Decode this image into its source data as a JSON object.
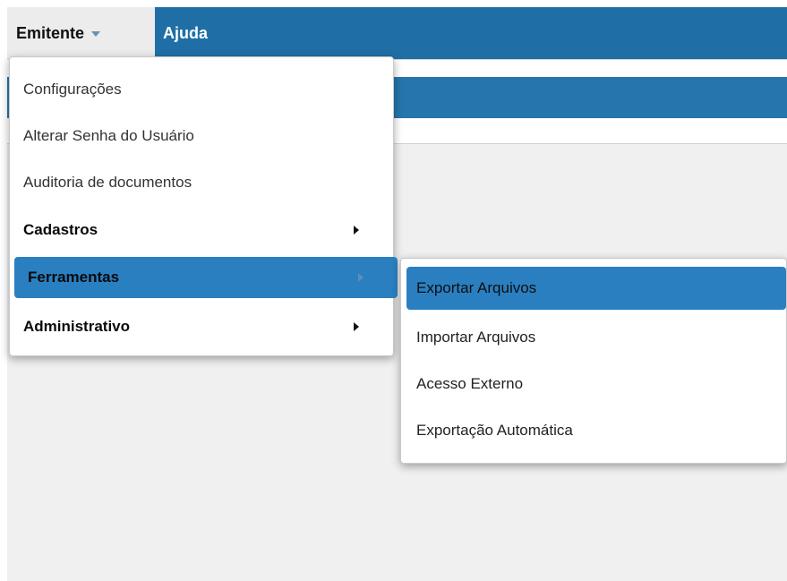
{
  "navbar": {
    "emitente_label": "Emitente",
    "ajuda_label": "Ajuda"
  },
  "dropdown": {
    "items": [
      {
        "label": "Configurações",
        "bold": false,
        "submenu": false
      },
      {
        "label": "Alterar Senha do Usuário",
        "bold": false,
        "submenu": false
      },
      {
        "label": "Auditoria de documentos",
        "bold": false,
        "submenu": false
      },
      {
        "label": "Cadastros",
        "bold": true,
        "submenu": true
      },
      {
        "label": "Ferramentas",
        "bold": true,
        "submenu": true,
        "active": true
      },
      {
        "label": "Administrativo",
        "bold": true,
        "submenu": true
      }
    ]
  },
  "submenu": {
    "items": [
      {
        "label": "Exportar Arquivos",
        "active": true
      },
      {
        "label": "Importar Arquivos"
      },
      {
        "label": "Acesso Externo"
      },
      {
        "label": "Exportação Automática"
      }
    ]
  },
  "colors": {
    "navbar_blue": "#1f6fa6",
    "highlight_blue": "#2a7fc0",
    "background": "#f0f0f0"
  },
  "icons": {
    "emitente_caret": "caret-down-icon",
    "submenu_arrow": "chevron-right-icon"
  }
}
